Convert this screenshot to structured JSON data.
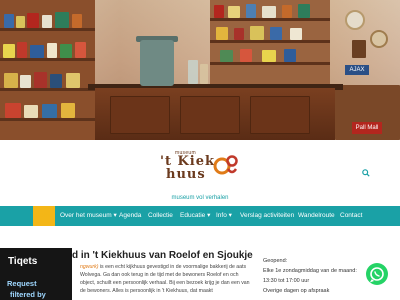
{
  "logo": {
    "small_text": "museum",
    "word1": "'t Kiek",
    "word2": "huus",
    "tagline": "museum vol verhalen"
  },
  "nav": {
    "items": [
      {
        "label": "Home"
      },
      {
        "label": "Over het museum ▾"
      },
      {
        "label": "Agenda"
      },
      {
        "label": "Collectie"
      },
      {
        "label": "Educatie ▾"
      },
      {
        "label": "Info ▾"
      },
      {
        "label": "Verslag activiteiten"
      },
      {
        "label": "Wandelroute"
      },
      {
        "label": "Contact"
      }
    ]
  },
  "main": {
    "heading": "d in 't Kiekhuus van Roelof en Sjoukje",
    "highlight": "ngwurk)",
    "body": " is een echt kijkhuus gevestigd in de voormalige bakkerij de aats Wolvega. Ga dan ook terug in de tijd met de bewoners Roelof en och object, schuilt een persoonlijk verhaal. Bij een bezoek krijg je dan een van de bewoners. Alles is persoonlijk in 't Kiekhuus, dat maakt"
  },
  "side": {
    "line1": "Geopend:",
    "line2": "Elke 1e zondagmiddag van de maand:",
    "line3": "13:30 tot 17:00 uur",
    "line4": "Overige dagen op afspraak"
  },
  "tiqets": {
    "brand": "Tiqets",
    "cta1": "Request",
    "cta2": "filtered by"
  },
  "hero": {
    "sign1": "Pall Mall",
    "sign2": "AJAX"
  },
  "colors": {
    "accent": "#1aa1a6",
    "active": "#f3b617",
    "brand_brown": "#6b3a1e",
    "whatsapp": "#25d366"
  },
  "icons": [
    "search-icon",
    "whatsapp-icon",
    "logo-face-icon"
  ]
}
